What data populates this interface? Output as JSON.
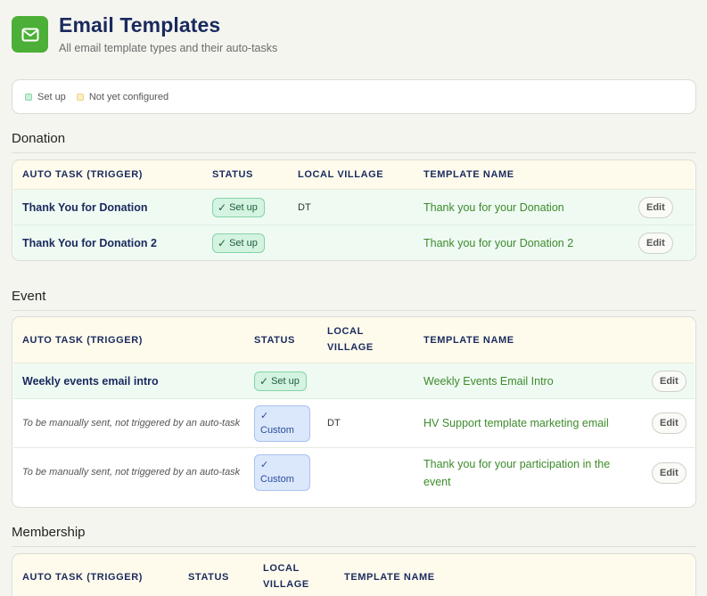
{
  "page": {
    "title": "Email Templates",
    "subtitle": "All email template types and their auto-tasks",
    "icon": "mail-icon",
    "accent": "#4caf37"
  },
  "legend": {
    "set_up": "Set up",
    "not_configured": "Not yet configured"
  },
  "columns": {
    "trigger": "AUTO TASK (TRIGGER)",
    "status": "STATUS",
    "village_line1": "LOCAL VILLAGE",
    "village_split_1": "LOCAL",
    "village_split_2": "VILLAGE",
    "template": "TEMPLATE NAME"
  },
  "sections": [
    {
      "title": "Donation",
      "rows": [
        {
          "trigger": "Thank You for Donation",
          "status": "Set up",
          "village": "DT",
          "template": "Thank you for your Donation",
          "action": "Edit"
        },
        {
          "trigger": "Thank You for Donation 2",
          "status": "Set up",
          "village": "",
          "template": "Thank you for your Donation 2",
          "action": "Edit"
        }
      ]
    },
    {
      "title": "Event",
      "rows": [
        {
          "trigger": "Weekly events email intro",
          "status": "Set up",
          "village": "",
          "template": "Weekly Events Email Intro",
          "action": "Edit"
        },
        {
          "trigger": "To be manually sent, not triggered by an auto-task",
          "status": "Custom",
          "village": "DT",
          "template": "HV Support template marketing email",
          "action": "Edit"
        },
        {
          "trigger": "To be manually sent, not triggered by an auto-task",
          "status": "Custom",
          "village": "",
          "template": "Thank you for your participation in the event",
          "action": "Edit"
        }
      ]
    },
    {
      "title": "Membership",
      "rows": []
    }
  ],
  "status_symbols": {
    "check": "✓"
  },
  "colors": {
    "title": "#1a2a5e",
    "template_link": "#3d8b2b",
    "setup_bg": "#d4f3e1",
    "custom_bg": "#dbe7fb",
    "header_bg": "#fefbec"
  }
}
